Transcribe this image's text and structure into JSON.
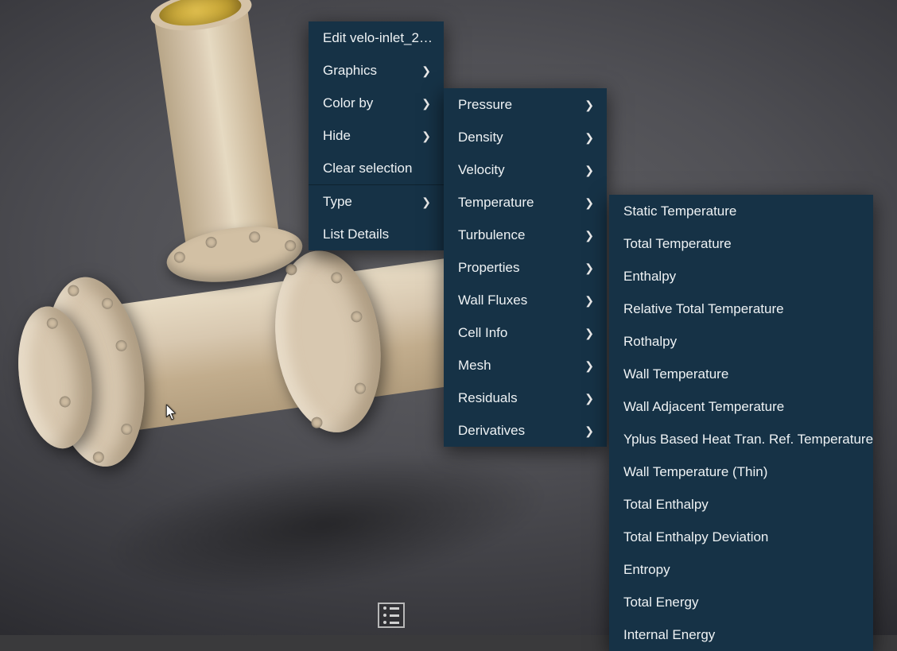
{
  "context_menu": {
    "items": [
      {
        "label": "Edit velo-inlet_2…",
        "has_submenu": false
      },
      {
        "label": "Graphics",
        "has_submenu": true
      },
      {
        "label": "Color by",
        "has_submenu": true
      },
      {
        "label": "Hide",
        "has_submenu": true
      },
      {
        "label": "Clear selection",
        "has_submenu": false
      },
      {
        "divider": true
      },
      {
        "label": "Type",
        "has_submenu": true
      },
      {
        "label": "List Details",
        "has_submenu": false
      }
    ]
  },
  "color_by_submenu": {
    "items": [
      {
        "label": "Pressure",
        "has_submenu": true
      },
      {
        "label": "Density",
        "has_submenu": true
      },
      {
        "label": "Velocity",
        "has_submenu": true
      },
      {
        "label": "Temperature",
        "has_submenu": true
      },
      {
        "label": "Turbulence",
        "has_submenu": true
      },
      {
        "label": "Properties",
        "has_submenu": true
      },
      {
        "label": "Wall Fluxes",
        "has_submenu": true
      },
      {
        "label": "Cell Info",
        "has_submenu": true
      },
      {
        "label": "Mesh",
        "has_submenu": true
      },
      {
        "label": "Residuals",
        "has_submenu": true
      },
      {
        "label": "Derivatives",
        "has_submenu": true
      }
    ]
  },
  "temperature_submenu": {
    "items": [
      {
        "label": "Static Temperature"
      },
      {
        "label": "Total Temperature"
      },
      {
        "label": "Enthalpy"
      },
      {
        "label": "Relative Total Temperature"
      },
      {
        "label": "Rothalpy"
      },
      {
        "label": "Wall Temperature"
      },
      {
        "label": "Wall Adjacent Temperature"
      },
      {
        "label": "Yplus Based Heat Tran. Ref. Temperature"
      },
      {
        "label": "Wall Temperature (Thin)"
      },
      {
        "label": "Total Enthalpy"
      },
      {
        "label": "Total Enthalpy Deviation"
      },
      {
        "label": "Entropy"
      },
      {
        "label": "Total Energy"
      },
      {
        "label": "Internal Energy"
      }
    ]
  },
  "icons": {
    "chevron": "❯"
  },
  "geometry": {
    "selected_object": "velo-inlet_2",
    "inlet_top_color": "#d8b636",
    "outlet_right_color": "#d58e85",
    "body_color": "#d8c8b0"
  }
}
